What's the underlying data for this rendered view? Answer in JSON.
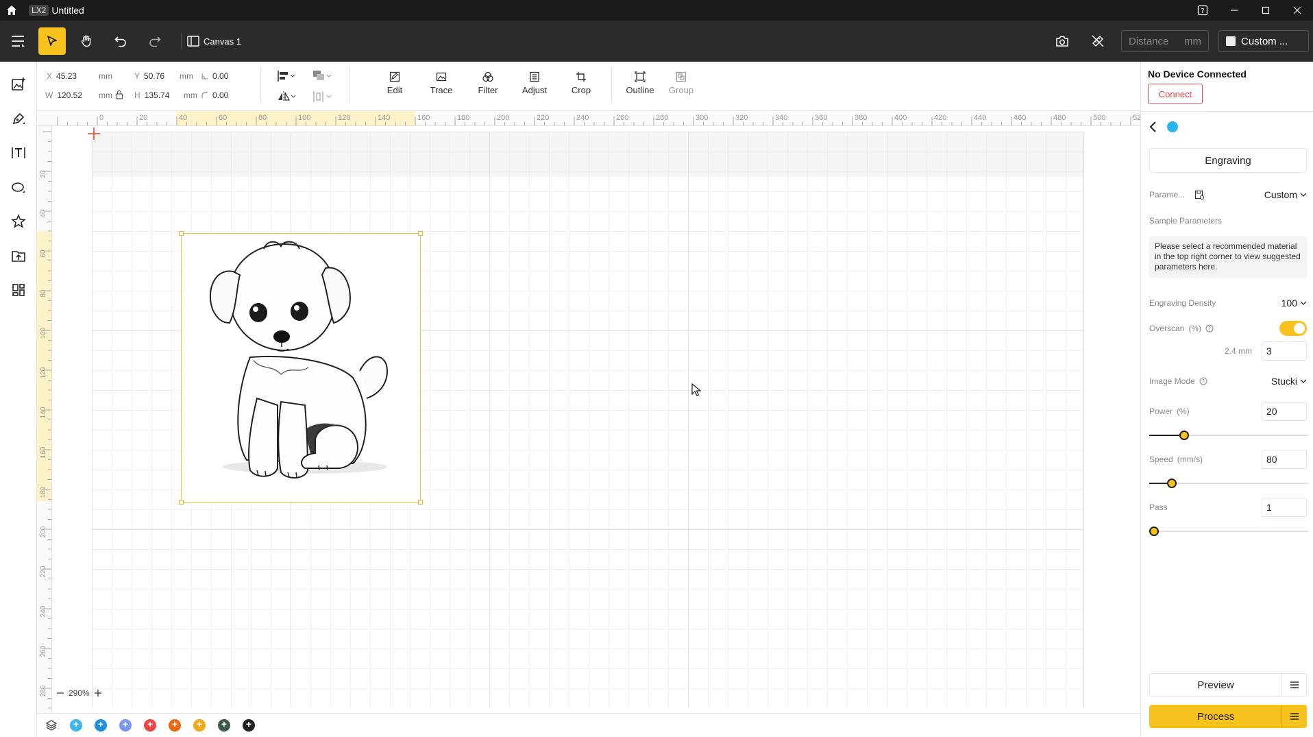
{
  "titlebar": {
    "app_badge": "LX2",
    "doc_title": "Untitled"
  },
  "toolbar": {
    "canvas_label": "Canvas 1",
    "distance_placeholder": "Distance",
    "distance_unit": "mm",
    "custom_label": "Custom ..."
  },
  "props": {
    "x": {
      "label": "X",
      "value": "45.23",
      "unit": "mm"
    },
    "y": {
      "label": "Y",
      "value": "50.76",
      "unit": "mm"
    },
    "angle": "0.00",
    "w": {
      "label": "W",
      "value": "120.52",
      "unit": "mm"
    },
    "h": {
      "label": "H",
      "value": "135.74",
      "unit": "mm"
    },
    "corner": "0.00"
  },
  "actions": {
    "edit": "Edit",
    "trace": "Trace",
    "filter": "Filter",
    "adjust": "Adjust",
    "crop": "Crop",
    "outline": "Outline",
    "group": "Group"
  },
  "ruler": {
    "h_ticks": [
      "0",
      "20",
      "40",
      "60",
      "80",
      "100",
      "120",
      "140",
      "160",
      "180",
      "200",
      "220",
      "240",
      "260",
      "280",
      "300",
      "320",
      "340",
      "360",
      "380",
      "400",
      "420",
      "440",
      "460",
      "480",
      "500",
      "520"
    ],
    "v_ticks": [
      "20",
      "40",
      "60",
      "80",
      "100",
      "120",
      "140",
      "160",
      "180",
      "200",
      "220",
      "240",
      "260",
      "280"
    ]
  },
  "zoom": {
    "value": "290%"
  },
  "layers": {
    "colors": [
      "#3fb6ea",
      "#1f8de0",
      "#7b97f0",
      "#ef4545",
      "#e76a12",
      "#f3a91c",
      "#3e5a4a",
      "#222222"
    ]
  },
  "panel": {
    "device_status": "No Device Connected",
    "connect_label": "Connect",
    "mode_tab": "Engraving",
    "params_label": "Parame...",
    "params_value": "Custom",
    "sample_label": "Sample Parameters",
    "hint": "Please select a recommended material in the top right corner to view suggested parameters here.",
    "density_label": "Engraving Density",
    "density_value": "100",
    "overscan_label": "Overscan",
    "overscan_unit": "(%)",
    "overscan_mm": "2.4 mm",
    "overscan_value": "3",
    "image_mode_label": "Image Mode",
    "image_mode_value": "Stucki",
    "power_label": "Power",
    "power_unit": "(%)",
    "power_value": "20",
    "power_fraction": 0.2,
    "speed_label": "Speed",
    "speed_unit": "(mm/s)",
    "speed_value": "80",
    "speed_fraction": 0.12,
    "pass_label": "Pass",
    "pass_value": "1",
    "pass_fraction": 0.0,
    "preview_label": "Preview",
    "process_label": "Process"
  }
}
